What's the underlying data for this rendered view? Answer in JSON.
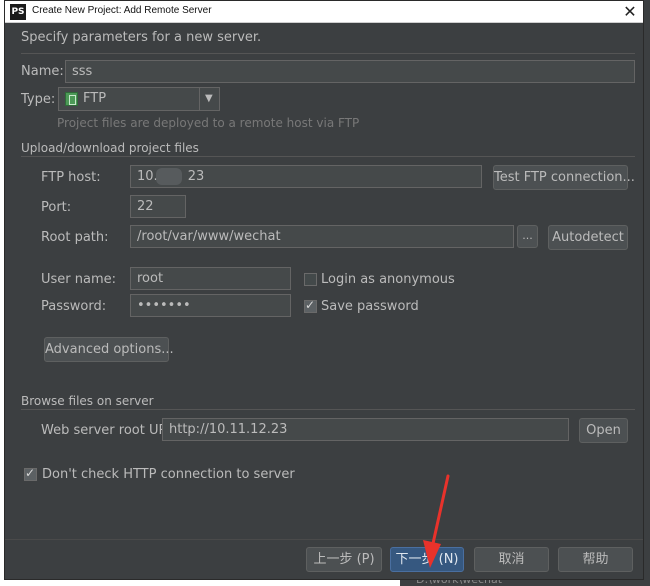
{
  "window": {
    "title": "Create New Project: Add Remote Server",
    "app_icon_text": "PS",
    "heading": "Specify parameters for a new server."
  },
  "form": {
    "name_label": "Name:",
    "name_value": "sss",
    "type_label": "Type:",
    "type_value": "FTP",
    "type_hint": "Project files are deployed to a remote host via FTP",
    "section_upload": "Upload/download project files",
    "ftp_host_label": "FTP host:",
    "ftp_host_value_prefix": "10.",
    "ftp_host_value_suffix": "23",
    "test_connection_label": "Test FTP connection...",
    "port_label": "Port:",
    "port_value": "22",
    "root_path_label": "Root path:",
    "root_path_value": "/root/var/www/wechat",
    "browse_button_label": "...",
    "autodetect_label": "Autodetect",
    "username_label": "User name:",
    "username_value": "root",
    "login_anonymous_label": "Login as anonymous",
    "password_label": "Password:",
    "password_value": "•••••••",
    "save_password_label": "Save password",
    "advanced_options_label": "Advanced options...",
    "section_browse": "Browse files on server",
    "web_root_label": "Web server root URL:",
    "web_root_value": "http://10.11.12.23",
    "open_label": "Open",
    "dont_check_http_label": "Don't check HTTP connection to server"
  },
  "state": {
    "login_anonymous_checked": false,
    "save_password_checked": true,
    "dont_check_http_checked": true
  },
  "buttons": {
    "prev": "上一步 (P)",
    "next": "下一步 (N)",
    "cancel": "取消",
    "help": "帮助"
  },
  "background": {
    "path_text": "D:\\work\\wechat"
  },
  "colors": {
    "dialog_bg": "#3c3f41",
    "field_bg": "#45494a",
    "text": "#bbbbbb",
    "default_button_bg": "#365880",
    "annotation_arrow": "#e8322b"
  }
}
